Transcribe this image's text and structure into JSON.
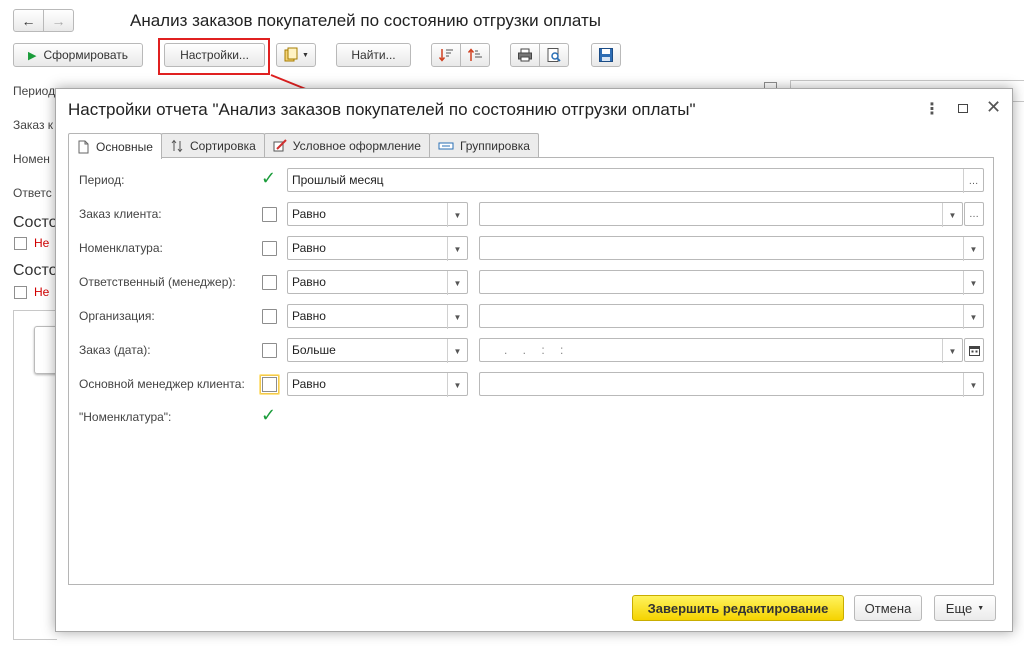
{
  "window": {
    "title": "Анализ заказов покупателей по состоянию отгрузки оплаты",
    "nav_back_icon": "←",
    "nav_forward_icon": "→"
  },
  "toolbar": {
    "generate_label": "Сформировать",
    "settings_label": "Настройки...",
    "find_label": "Найти...",
    "highlight_color": "#e02020"
  },
  "background_form": {
    "labels": [
      "Период",
      "Заказ к",
      "Номен",
      "Ответс"
    ],
    "sections": [
      "Состо",
      "Состо"
    ],
    "red_items": [
      "Не",
      "Не"
    ]
  },
  "dialog": {
    "title": "Настройки отчета \"Анализ заказов покупателей по состоянию отгрузки оплаты\"",
    "tabs": [
      {
        "label": "Основные",
        "icon": "document-icon"
      },
      {
        "label": "Сортировка",
        "icon": "sort-icon"
      },
      {
        "label": "Условное оформление",
        "icon": "brush-icon"
      },
      {
        "label": "Группировка",
        "icon": "grouping-icon"
      }
    ],
    "rows": [
      {
        "label": "Период:",
        "checked": true,
        "value": "Прошлый месяц"
      },
      {
        "label": "Заказ клиента:",
        "checked": false,
        "condition": "Равно",
        "value": ""
      },
      {
        "label": "Номенклатура:",
        "checked": false,
        "condition": "Равно",
        "value": ""
      },
      {
        "label": "Ответственный (менеджер):",
        "checked": false,
        "condition": "Равно",
        "value": ""
      },
      {
        "label": "Организация:",
        "checked": false,
        "condition": "Равно",
        "value": ""
      },
      {
        "label": "Заказ (дата):",
        "checked": false,
        "condition": "Больше",
        "value": ". .   : :"
      },
      {
        "label": "Основной менеджер клиента:",
        "checked": false,
        "condition": "Равно",
        "value": ""
      },
      {
        "label": "\"Номенклатура\":",
        "checked": true
      }
    ],
    "buttons": {
      "finish": "Завершить редактирование",
      "cancel": "Отмена",
      "more": "Еще"
    }
  },
  "colors": {
    "check_green": "#1a9c3a",
    "primary_yellow": "#f5d300"
  }
}
